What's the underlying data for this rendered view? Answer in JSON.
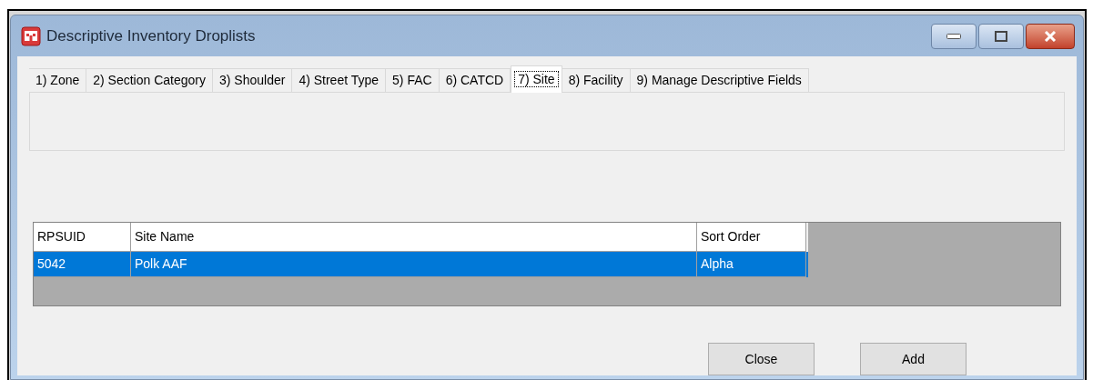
{
  "window": {
    "title": "Descriptive Inventory Droplists"
  },
  "tabs": [
    {
      "label": "1) Zone",
      "selected": false
    },
    {
      "label": "2) Section Category",
      "selected": false
    },
    {
      "label": "3) Shoulder",
      "selected": false
    },
    {
      "label": "4) Street Type",
      "selected": false
    },
    {
      "label": "5) FAC",
      "selected": false
    },
    {
      "label": "6) CATCD",
      "selected": false
    },
    {
      "label": "7) Site",
      "selected": true
    },
    {
      "label": "8) Facility",
      "selected": false
    },
    {
      "label": "9) Manage Descriptive Fields",
      "selected": false
    }
  ],
  "table": {
    "columns": [
      "RPSUID",
      "Site Name",
      "Sort Order"
    ],
    "rows": [
      {
        "cells": [
          "5042",
          "Polk AAF",
          "Alpha"
        ],
        "selected": true
      }
    ]
  },
  "buttons": [
    "Close",
    "Add"
  ]
}
